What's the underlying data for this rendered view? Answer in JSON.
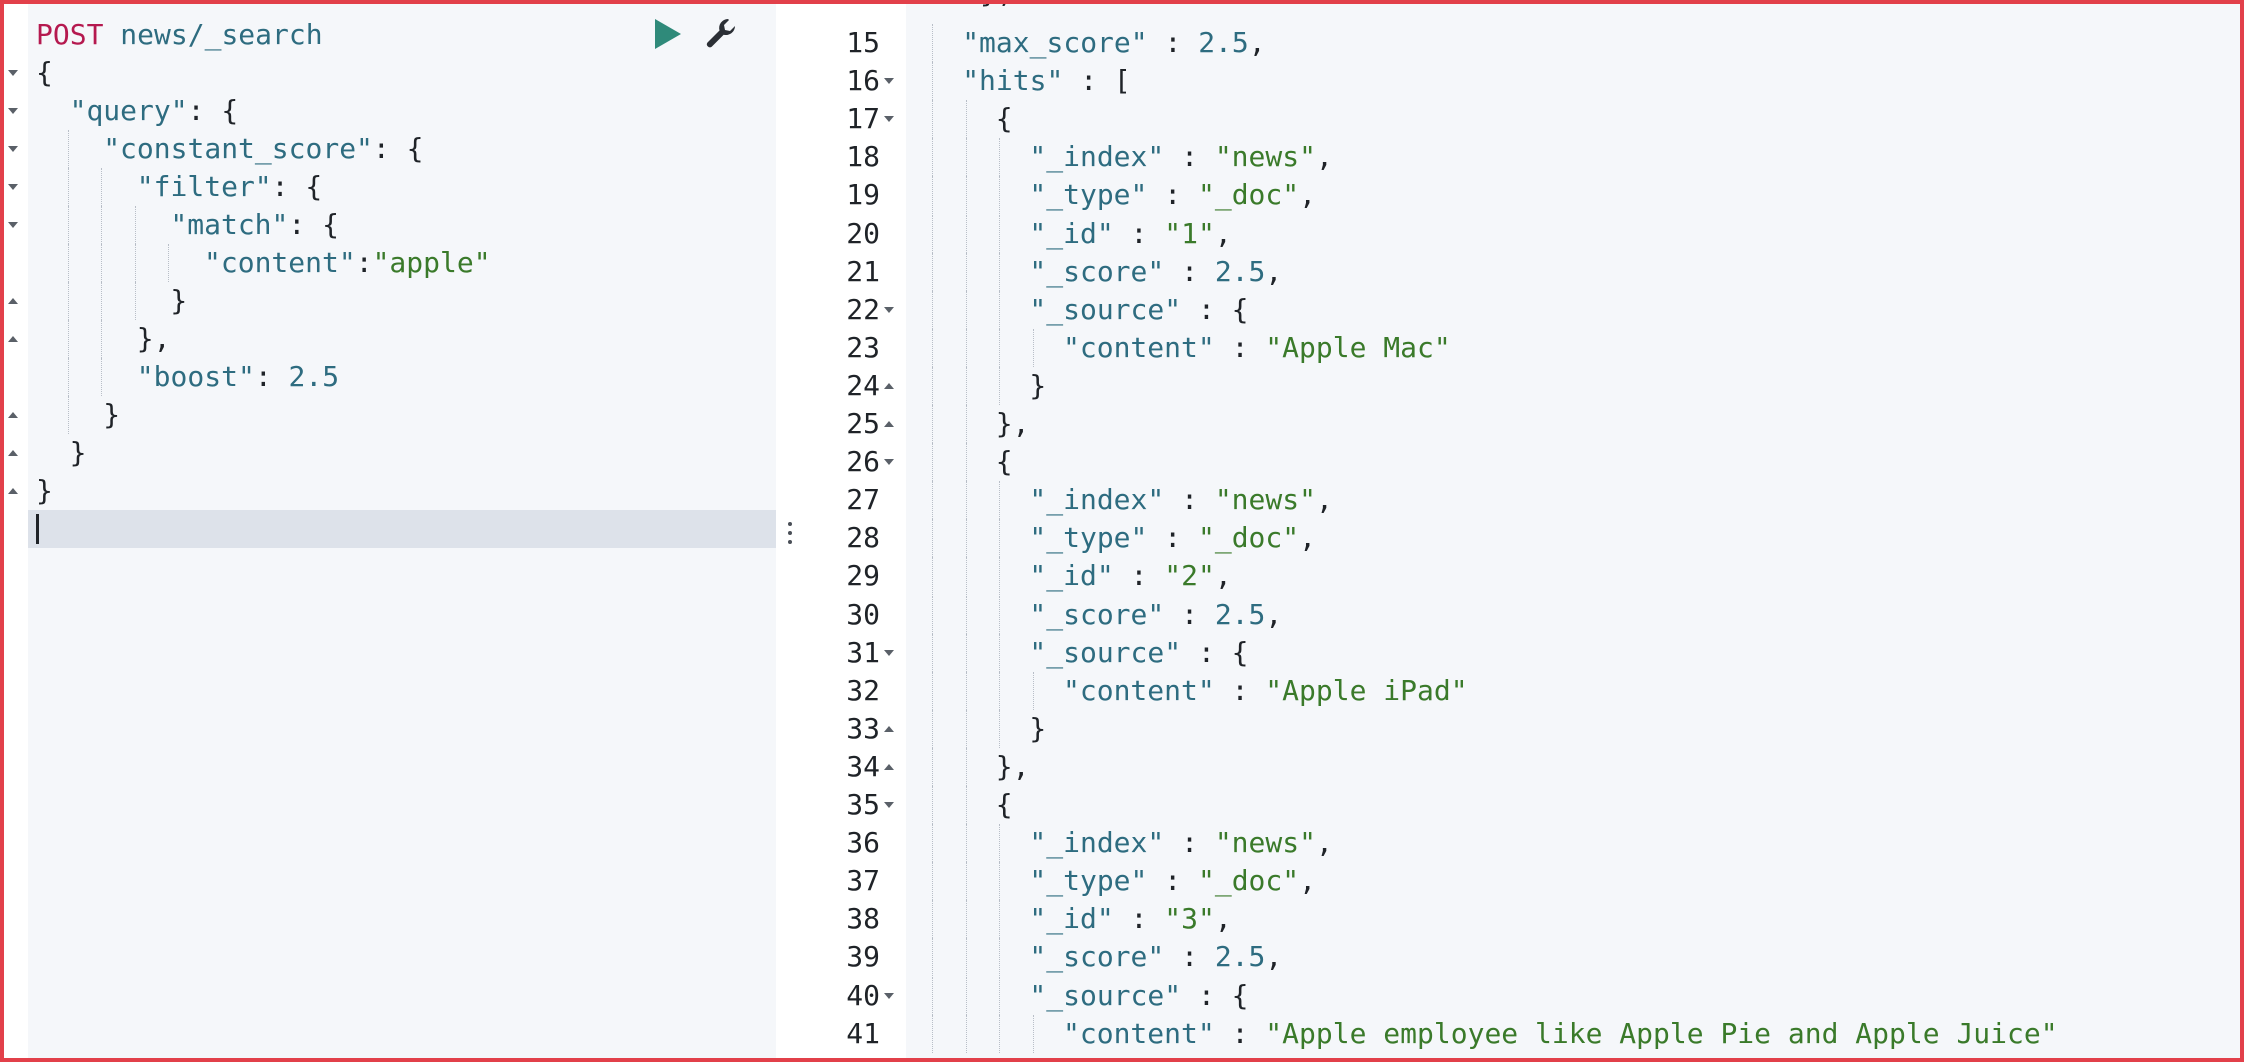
{
  "request": {
    "method": "POST",
    "endpoint": "news/_search",
    "run_label": "",
    "settings_label": ""
  },
  "request_body": [
    {
      "indent": 0,
      "fold": "down",
      "tokens": [
        {
          "t": "{",
          "c": "punc"
        }
      ]
    },
    {
      "indent": 1,
      "fold": "down",
      "tokens": [
        {
          "t": "\"query\"",
          "c": "key"
        },
        {
          "t": ": {",
          "c": "punc"
        }
      ]
    },
    {
      "indent": 2,
      "fold": "down",
      "tokens": [
        {
          "t": "\"constant_score\"",
          "c": "key"
        },
        {
          "t": ": {",
          "c": "punc"
        }
      ]
    },
    {
      "indent": 3,
      "fold": "down",
      "tokens": [
        {
          "t": "\"filter\"",
          "c": "key"
        },
        {
          "t": ": {",
          "c": "punc"
        }
      ]
    },
    {
      "indent": 4,
      "fold": "down",
      "tokens": [
        {
          "t": "\"match\"",
          "c": "key"
        },
        {
          "t": ": {",
          "c": "punc"
        }
      ]
    },
    {
      "indent": 5,
      "fold": "",
      "tokens": [
        {
          "t": "\"content\"",
          "c": "key"
        },
        {
          "t": ":",
          "c": "punc"
        },
        {
          "t": "\"apple\"",
          "c": "str"
        }
      ]
    },
    {
      "indent": 4,
      "fold": "up",
      "tokens": [
        {
          "t": "}",
          "c": "punc"
        }
      ]
    },
    {
      "indent": 3,
      "fold": "up",
      "tokens": [
        {
          "t": "},",
          "c": "punc"
        }
      ]
    },
    {
      "indent": 3,
      "fold": "",
      "tokens": [
        {
          "t": "\"boost\"",
          "c": "key"
        },
        {
          "t": ": ",
          "c": "punc"
        },
        {
          "t": "2.5",
          "c": "num"
        }
      ]
    },
    {
      "indent": 2,
      "fold": "up",
      "tokens": [
        {
          "t": "}",
          "c": "punc"
        }
      ]
    },
    {
      "indent": 1,
      "fold": "up",
      "tokens": [
        {
          "t": "}",
          "c": "punc"
        }
      ]
    },
    {
      "indent": 0,
      "fold": "up",
      "tokens": [
        {
          "t": "}",
          "c": "punc"
        }
      ]
    }
  ],
  "response_lines": [
    {
      "n": "15",
      "indent": 1,
      "fold": "",
      "tokens": [
        {
          "t": "\"max_score\"",
          "c": "key"
        },
        {
          "t": " : ",
          "c": "punc"
        },
        {
          "t": "2.5",
          "c": "num"
        },
        {
          "t": ",",
          "c": "punc"
        }
      ]
    },
    {
      "n": "16",
      "indent": 1,
      "fold": "down",
      "tokens": [
        {
          "t": "\"hits\"",
          "c": "key"
        },
        {
          "t": " : [",
          "c": "punc"
        }
      ]
    },
    {
      "n": "17",
      "indent": 2,
      "fold": "down",
      "tokens": [
        {
          "t": "{",
          "c": "punc"
        }
      ]
    },
    {
      "n": "18",
      "indent": 3,
      "fold": "",
      "tokens": [
        {
          "t": "\"_index\"",
          "c": "key"
        },
        {
          "t": " : ",
          "c": "punc"
        },
        {
          "t": "\"news\"",
          "c": "str"
        },
        {
          "t": ",",
          "c": "punc"
        }
      ]
    },
    {
      "n": "19",
      "indent": 3,
      "fold": "",
      "tokens": [
        {
          "t": "\"_type\"",
          "c": "key"
        },
        {
          "t": " : ",
          "c": "punc"
        },
        {
          "t": "\"_doc\"",
          "c": "str"
        },
        {
          "t": ",",
          "c": "punc"
        }
      ]
    },
    {
      "n": "20",
      "indent": 3,
      "fold": "",
      "tokens": [
        {
          "t": "\"_id\"",
          "c": "key"
        },
        {
          "t": " : ",
          "c": "punc"
        },
        {
          "t": "\"1\"",
          "c": "str"
        },
        {
          "t": ",",
          "c": "punc"
        }
      ]
    },
    {
      "n": "21",
      "indent": 3,
      "fold": "",
      "tokens": [
        {
          "t": "\"_score\"",
          "c": "key"
        },
        {
          "t": " : ",
          "c": "punc"
        },
        {
          "t": "2.5",
          "c": "num"
        },
        {
          "t": ",",
          "c": "punc"
        }
      ]
    },
    {
      "n": "22",
      "indent": 3,
      "fold": "down",
      "tokens": [
        {
          "t": "\"_source\"",
          "c": "key"
        },
        {
          "t": " : {",
          "c": "punc"
        }
      ]
    },
    {
      "n": "23",
      "indent": 4,
      "fold": "",
      "tokens": [
        {
          "t": "\"content\"",
          "c": "key"
        },
        {
          "t": " : ",
          "c": "punc"
        },
        {
          "t": "\"Apple Mac\"",
          "c": "str"
        }
      ]
    },
    {
      "n": "24",
      "indent": 3,
      "fold": "up",
      "tokens": [
        {
          "t": "}",
          "c": "punc"
        }
      ]
    },
    {
      "n": "25",
      "indent": 2,
      "fold": "up",
      "tokens": [
        {
          "t": "},",
          "c": "punc"
        }
      ]
    },
    {
      "n": "26",
      "indent": 2,
      "fold": "down",
      "tokens": [
        {
          "t": "{",
          "c": "punc"
        }
      ]
    },
    {
      "n": "27",
      "indent": 3,
      "fold": "",
      "tokens": [
        {
          "t": "\"_index\"",
          "c": "key"
        },
        {
          "t": " : ",
          "c": "punc"
        },
        {
          "t": "\"news\"",
          "c": "str"
        },
        {
          "t": ",",
          "c": "punc"
        }
      ]
    },
    {
      "n": "28",
      "indent": 3,
      "fold": "",
      "tokens": [
        {
          "t": "\"_type\"",
          "c": "key"
        },
        {
          "t": " : ",
          "c": "punc"
        },
        {
          "t": "\"_doc\"",
          "c": "str"
        },
        {
          "t": ",",
          "c": "punc"
        }
      ]
    },
    {
      "n": "29",
      "indent": 3,
      "fold": "",
      "tokens": [
        {
          "t": "\"_id\"",
          "c": "key"
        },
        {
          "t": " : ",
          "c": "punc"
        },
        {
          "t": "\"2\"",
          "c": "str"
        },
        {
          "t": ",",
          "c": "punc"
        }
      ]
    },
    {
      "n": "30",
      "indent": 3,
      "fold": "",
      "tokens": [
        {
          "t": "\"_score\"",
          "c": "key"
        },
        {
          "t": " : ",
          "c": "punc"
        },
        {
          "t": "2.5",
          "c": "num"
        },
        {
          "t": ",",
          "c": "punc"
        }
      ]
    },
    {
      "n": "31",
      "indent": 3,
      "fold": "down",
      "tokens": [
        {
          "t": "\"_source\"",
          "c": "key"
        },
        {
          "t": " : {",
          "c": "punc"
        }
      ]
    },
    {
      "n": "32",
      "indent": 4,
      "fold": "",
      "tokens": [
        {
          "t": "\"content\"",
          "c": "key"
        },
        {
          "t": " : ",
          "c": "punc"
        },
        {
          "t": "\"Apple iPad\"",
          "c": "str"
        }
      ]
    },
    {
      "n": "33",
      "indent": 3,
      "fold": "up",
      "tokens": [
        {
          "t": "}",
          "c": "punc"
        }
      ]
    },
    {
      "n": "34",
      "indent": 2,
      "fold": "up",
      "tokens": [
        {
          "t": "},",
          "c": "punc"
        }
      ]
    },
    {
      "n": "35",
      "indent": 2,
      "fold": "down",
      "tokens": [
        {
          "t": "{",
          "c": "punc"
        }
      ]
    },
    {
      "n": "36",
      "indent": 3,
      "fold": "",
      "tokens": [
        {
          "t": "\"_index\"",
          "c": "key"
        },
        {
          "t": " : ",
          "c": "punc"
        },
        {
          "t": "\"news\"",
          "c": "str"
        },
        {
          "t": ",",
          "c": "punc"
        }
      ]
    },
    {
      "n": "37",
      "indent": 3,
      "fold": "",
      "tokens": [
        {
          "t": "\"_type\"",
          "c": "key"
        },
        {
          "t": " : ",
          "c": "punc"
        },
        {
          "t": "\"_doc\"",
          "c": "str"
        },
        {
          "t": ",",
          "c": "punc"
        }
      ]
    },
    {
      "n": "38",
      "indent": 3,
      "fold": "",
      "tokens": [
        {
          "t": "\"_id\"",
          "c": "key"
        },
        {
          "t": " : ",
          "c": "punc"
        },
        {
          "t": "\"3\"",
          "c": "str"
        },
        {
          "t": ",",
          "c": "punc"
        }
      ]
    },
    {
      "n": "39",
      "indent": 3,
      "fold": "",
      "tokens": [
        {
          "t": "\"_score\"",
          "c": "key"
        },
        {
          "t": " : ",
          "c": "punc"
        },
        {
          "t": "2.5",
          "c": "num"
        },
        {
          "t": ",",
          "c": "punc"
        }
      ]
    },
    {
      "n": "40",
      "indent": 3,
      "fold": "down",
      "tokens": [
        {
          "t": "\"_source\"",
          "c": "key"
        },
        {
          "t": " : {",
          "c": "punc"
        }
      ]
    },
    {
      "n": "41",
      "indent": 4,
      "fold": "",
      "tokens": [
        {
          "t": "\"content\"",
          "c": "key"
        },
        {
          "t": " : ",
          "c": "punc"
        },
        {
          "t": "\"Apple employee like Apple Pie and Apple Juice\"",
          "c": "str"
        }
      ]
    }
  ],
  "colors": {
    "method": "#b5194f",
    "key": "#2e6c80",
    "string": "#3a7a2a",
    "number": "#2e6c80",
    "run_button": "#2f8a7a",
    "frame": "#e2404a"
  },
  "icons": {
    "run": "play-triangle",
    "settings": "wrench"
  }
}
